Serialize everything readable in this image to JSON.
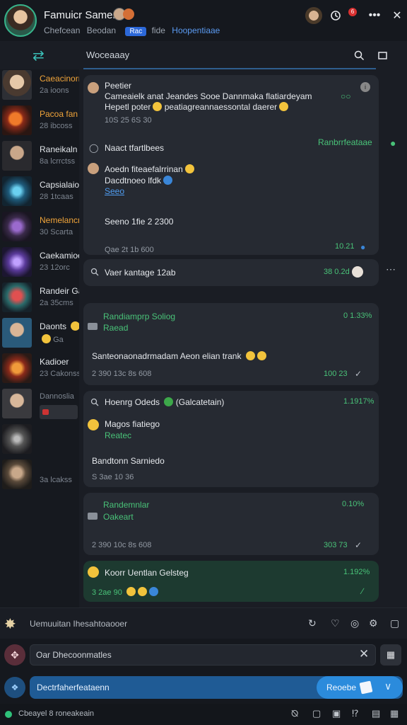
{
  "header": {
    "name": "Famuicr Samer",
    "sub_a": "Chefcean",
    "sub_b": "Beodan",
    "sub_pill": "Rac",
    "sub_c": "fide",
    "sub_link": "Hoopentiaae",
    "badge": "6"
  },
  "toolbar": {
    "title": "Woceaaay"
  },
  "sidebar": {
    "items": [
      {
        "t1": "Caeacinorr",
        "t2": "2a ioons"
      },
      {
        "t1": "Pacoa fan",
        "t2": "28 ibcoss"
      },
      {
        "t1": "Raneikaln",
        "t2": "8a lcrrctss"
      },
      {
        "t1": "Capsialaiod",
        "t2": "28 1tcaas"
      },
      {
        "t1": "Nemelancn",
        "t2": "30 Scarta"
      },
      {
        "t1": "Caekamioe",
        "t2": "23 12orc"
      },
      {
        "t1": "Randeir Ga",
        "t2": "2a 35cms"
      },
      {
        "t1": "Daonts",
        "t2": "Ga"
      },
      {
        "t1": "Kadioer",
        "t2": "23 Cakonss"
      },
      {
        "t1": "Dannoslia",
        "t2": ""
      },
      {
        "t1": "",
        "t2": ""
      },
      {
        "t1": "",
        "t2": "3a lcakss"
      }
    ]
  },
  "messages": {
    "c1": {
      "sender": "Peetier",
      "line1": "Cameaielk anat Jeandes Sooe Dannmaka flatiardeyam",
      "line2": "Hepetl poter",
      "line2b": "peatiagreannaessontal daerer",
      "time": "10S 25 6S 30",
      "sub1": "Naact tfartlbees",
      "sub1r": "Ranbrrfeataae",
      "sub2a": "Aoedn fiteaefalrrinan",
      "sub2b": "Dacdtnoeo lfdk",
      "link": "Seeo",
      "sub3": "Seeno 1fie 2 2300",
      "stamp": "Qae 2t 1b 600",
      "stamp_r": "10.21"
    },
    "search": {
      "text": "Vaer kantage 12ab",
      "time": "38 0.2d"
    },
    "c2": {
      "title": "Randiamprp Soliog",
      "pct": "0 1.33%",
      "sub": "Raead",
      "body": "Santeonaonadrmadam Aeon elian trank",
      "time": "2 390 13c 8s 608",
      "time_r": "100 23"
    },
    "c3": {
      "title": "Hoenrg Odeds",
      "paren": "(Galcatetain)",
      "pct": "1.1917%",
      "sub1": "Magos fiatiego",
      "sub1b": "Reatec",
      "body": "Bandtonn Sarniedo",
      "time": "S 3ae 10 36"
    },
    "c4": {
      "title": "Randemnlar",
      "pct": "0.10%",
      "sub": "Oakeart",
      "time": "2 390 10c 8s 608",
      "time_r": "303 73"
    },
    "c5": {
      "title": "Koorr Uentlan Gelsteg",
      "pct": "1.192%",
      "time": "3 2ae 90"
    }
  },
  "composer": {
    "label": "Uemuuitan Ihesahtoaooer",
    "input": "Oar Dhecoonmatles",
    "blue_label": "Dectrfaherfeataenn",
    "send_label": "Reoebe"
  },
  "status": {
    "text": "Cbeayel 8 roneakeain"
  }
}
